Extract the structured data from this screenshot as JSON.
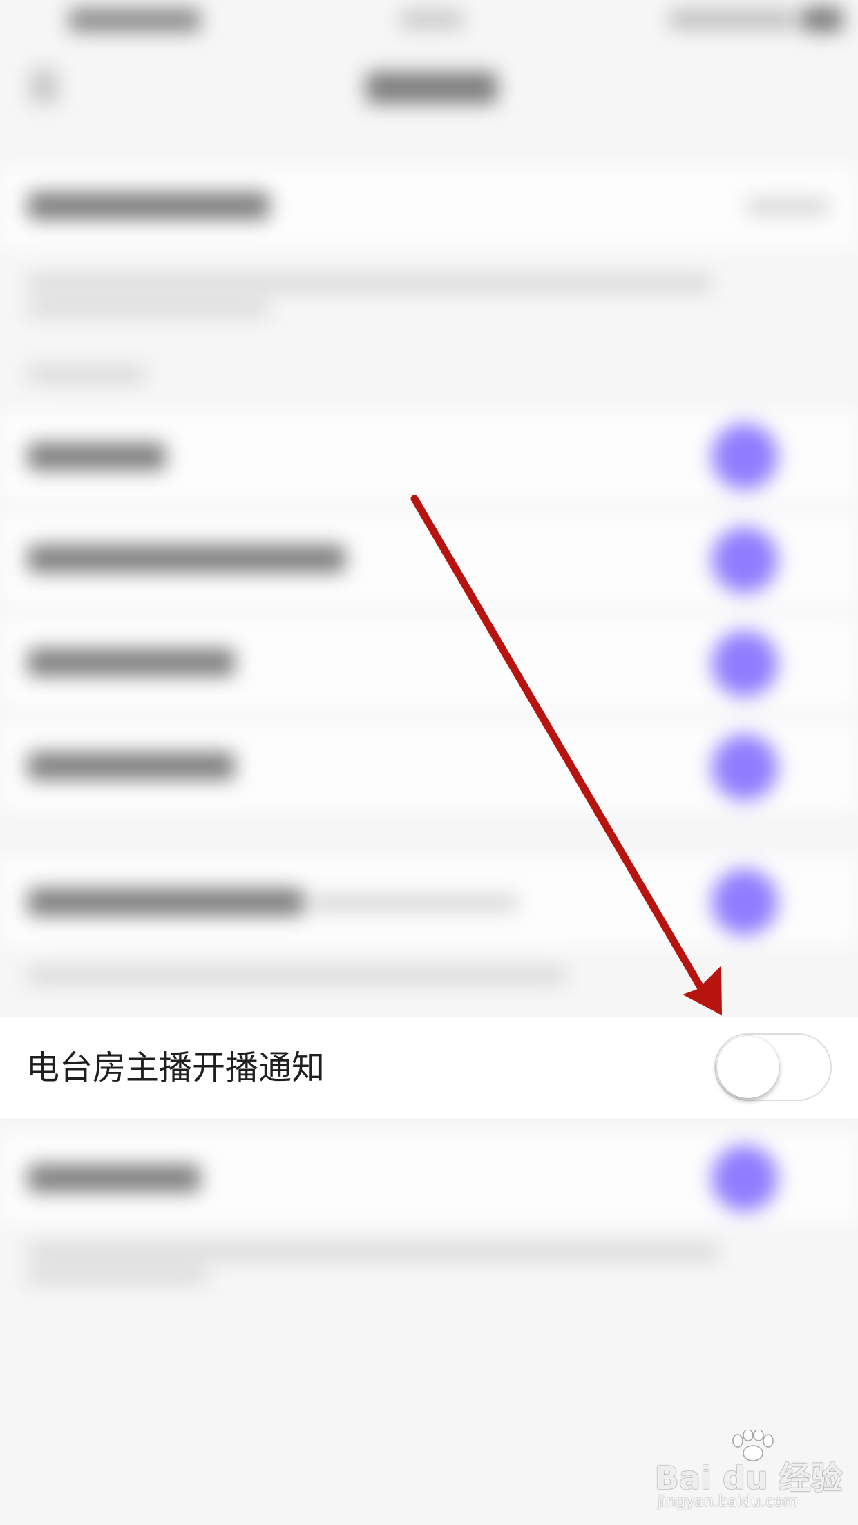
{
  "notification_row": {
    "label": "电台房主播开播通知",
    "toggle_on": false
  },
  "colors": {
    "accent_toggle": "#8f7dff",
    "annotation_arrow": "#b8140f"
  },
  "watermark": {
    "brand": "Bai du 经验",
    "url": "jingyan.baidu.com"
  }
}
